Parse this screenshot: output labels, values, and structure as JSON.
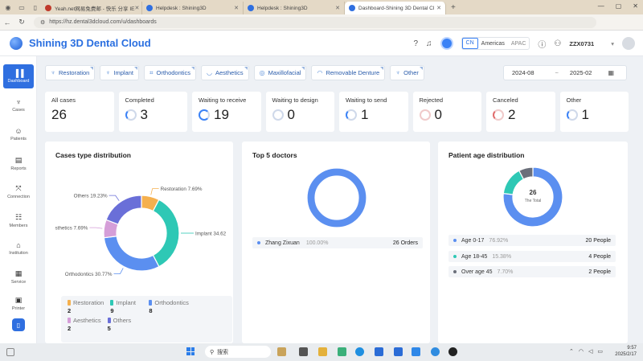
{
  "browser": {
    "tabs": [
      {
        "title": "Yeah.net网易免费邮 - 快乐 分享 IE",
        "color": "#c0392b"
      },
      {
        "title": "Helpdesk : Shining3D",
        "color": "#2f6fe0"
      },
      {
        "title": "Helpdesk : Shining3D",
        "color": "#2f6fe0"
      },
      {
        "title": "Dashboard-Shining 3D Dental Cl",
        "color": "#2f6fe0"
      }
    ],
    "url": "https://hz.dental3dcloud.com/u/dashboards"
  },
  "header": {
    "brand": "Shining 3D Dental Cloud",
    "region_cn": "CN",
    "region_americas": "Americas",
    "region_apac": "APAC",
    "user": "ZZX0731"
  },
  "sidebar": {
    "items": [
      {
        "label": "Dashboard",
        "icon": "▮▮▮"
      },
      {
        "label": "Cases",
        "icon": "⚲"
      },
      {
        "label": "Patients",
        "icon": "☺"
      },
      {
        "label": "Reports",
        "icon": "▤"
      },
      {
        "label": "Connection",
        "icon": "⤧"
      },
      {
        "label": "Members",
        "icon": "☷"
      },
      {
        "label": "Institution",
        "icon": "⌂"
      },
      {
        "label": "Service",
        "icon": "▦"
      },
      {
        "label": "Printer",
        "icon": "▣"
      }
    ]
  },
  "categories": [
    {
      "label": "Restoration",
      "icon": "♆"
    },
    {
      "label": "Implant",
      "icon": "♆"
    },
    {
      "label": "Orthodontics",
      "icon": "⌗"
    },
    {
      "label": "Aesthetics",
      "icon": "◡"
    },
    {
      "label": "Maxillofacial",
      "icon": "◎"
    },
    {
      "label": "Removable Denture",
      "icon": "◠"
    },
    {
      "label": "Other",
      "icon": "♆"
    }
  ],
  "date_range": {
    "start": "2024-08",
    "sep": "~",
    "end": "2025-02"
  },
  "stats": [
    {
      "label": "All cases",
      "value": "26",
      "ring": "none",
      "ring_color": "#cfd9ea"
    },
    {
      "label": "Completed",
      "value": "3",
      "ring": "partial",
      "ring_color": "#3b82f6"
    },
    {
      "label": "Waiting to receive",
      "value": "19",
      "ring": "mostly",
      "ring_color": "#3b82f6"
    },
    {
      "label": "Waiting to design",
      "value": "0",
      "ring": "empty",
      "ring_color": "#cfd9ea"
    },
    {
      "label": "Waiting to send",
      "value": "1",
      "ring": "partial",
      "ring_color": "#3b82f6"
    },
    {
      "label": "Rejected",
      "value": "0",
      "ring": "empty",
      "ring_color": "#e8c4c4"
    },
    {
      "label": "Canceled",
      "value": "2",
      "ring": "partial",
      "ring_color": "#e06b6b"
    },
    {
      "label": "Other",
      "value": "1",
      "ring": "partial",
      "ring_color": "#3b82f6"
    }
  ],
  "panels": {
    "cases_title": "Cases type distribution",
    "doctors_title": "Top 5 doctors",
    "age_title": "Patient age distribution"
  },
  "chart_data": [
    {
      "type": "pie",
      "title": "Cases type distribution",
      "categories": [
        "Restoration",
        "Implant",
        "Orthodontics",
        "Aesthetics",
        "Others"
      ],
      "values": [
        2,
        9,
        8,
        2,
        5
      ],
      "percent_labels": [
        "Restoration 7.69%",
        "Implant 34.62",
        "Orthodontics 30.77%",
        "sthetics 7.69%",
        "Others 19.23%"
      ],
      "colors": [
        "#f5b04e",
        "#2ec8b5",
        "#5b8ff0",
        "#d59ed8",
        "#6a6fd8"
      ]
    },
    {
      "type": "pie",
      "title": "Top 5 doctors",
      "categories": [
        "Zhang Zixuan"
      ],
      "values": [
        26
      ],
      "percent_labels": [
        "100.00%"
      ],
      "value_labels": [
        "26 Orders"
      ],
      "colors": [
        "#5b8ff0"
      ]
    },
    {
      "type": "pie",
      "title": "Patient age distribution",
      "categories": [
        "Age 0-17",
        "Age 18-45",
        "Over age 45"
      ],
      "values": [
        20,
        4,
        2
      ],
      "percent_labels": [
        "76.92%",
        "15.38%",
        "7.70%"
      ],
      "value_labels": [
        "20 People",
        "4 People",
        "2 People"
      ],
      "colors": [
        "#5b8ff0",
        "#2ec8b5",
        "#6b6f7a"
      ],
      "center_value": "26",
      "center_label": "The Total"
    }
  ],
  "taskbar": {
    "search": "搜索",
    "time": "9:57",
    "date": "2025/2/17"
  }
}
